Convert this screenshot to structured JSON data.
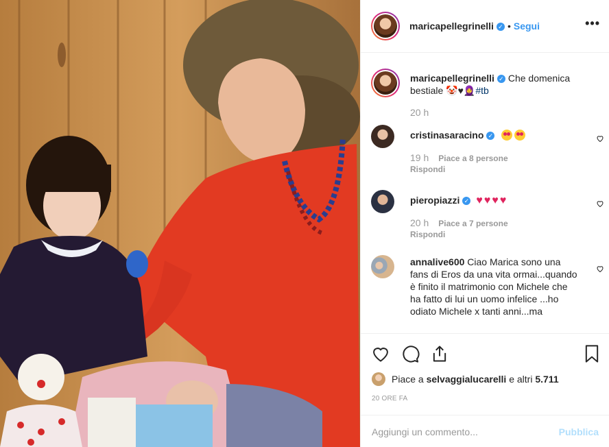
{
  "post": {
    "author": "maricapellegrinelli",
    "follow_label": "Segui",
    "dot": "•",
    "more_label": "•••",
    "caption": {
      "text": "Che domenica bestiale",
      "emojis": "🤡♥🧕",
      "hashtag": "#tb",
      "time": "20 h"
    }
  },
  "comments": [
    {
      "user": "cristinasaracino",
      "verified": true,
      "text": "",
      "emoji_count": 2,
      "time": "19 h",
      "likes": "Piace a 8 persone",
      "reply": "Rispondi"
    },
    {
      "user": "pieropiazzi",
      "verified": true,
      "text": "",
      "hearts": "♥♥♥♥",
      "time": "20 h",
      "likes": "Piace a 7 persone",
      "reply": "Rispondi"
    },
    {
      "user": "annalive600",
      "verified": false,
      "text": "Ciao Marica sono una fans di Eros da una vita ormai...quando è finito il matrimonio con Michele che ha fatto di lui un uomo infelice ...ho odiato Michele x tanti anni...ma"
    }
  ],
  "actions": {
    "likes_prefix": "Piace a",
    "liked_by": "selvaggialucarelli",
    "likes_suffix": "e altri",
    "likes_count": "5.711",
    "ago": "20 ORE FA",
    "comment_placeholder": "Aggiungi un commento...",
    "publish_label": "Pubblica"
  },
  "icons": [
    "heart-icon",
    "comment-icon",
    "share-icon",
    "bookmark-icon",
    "verified-icon",
    "more-icon"
  ],
  "colors": {
    "link": "#3897f0",
    "muted": "#999999",
    "border": "#efefef",
    "heart": "#e0245e"
  }
}
